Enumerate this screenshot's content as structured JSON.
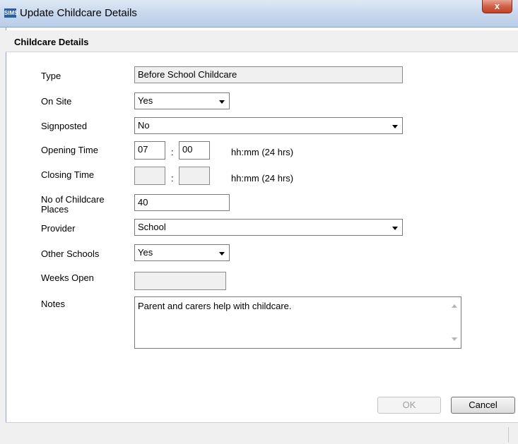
{
  "window": {
    "app_icon": "SIMS",
    "title": "Update Childcare Details",
    "close_label": "x"
  },
  "section": {
    "title": "Childcare Details"
  },
  "fields": {
    "type": {
      "label": "Type",
      "value": "Before School Childcare"
    },
    "on_site": {
      "label": "On Site",
      "value": "Yes"
    },
    "signposted": {
      "label": "Signposted",
      "value": "No"
    },
    "opening_time": {
      "label": "Opening Time",
      "hours": "07",
      "minutes": "00",
      "separator": ":",
      "hint": "hh:mm (24 hrs)"
    },
    "closing_time": {
      "label": "Closing Time",
      "hours": "",
      "minutes": "",
      "separator": ":",
      "hint": "hh:mm (24 hrs)"
    },
    "places": {
      "label_line1": "No of Childcare",
      "label_line2": "Places",
      "value": "40"
    },
    "provider": {
      "label": "Provider",
      "value": "School"
    },
    "other_schools": {
      "label": "Other Schools",
      "value": "Yes"
    },
    "weeks_open": {
      "label": "Weeks Open",
      "value": ""
    },
    "notes": {
      "label": "Notes",
      "value": "Parent and carers help with childcare."
    }
  },
  "buttons": {
    "ok": "OK",
    "cancel": "Cancel"
  }
}
